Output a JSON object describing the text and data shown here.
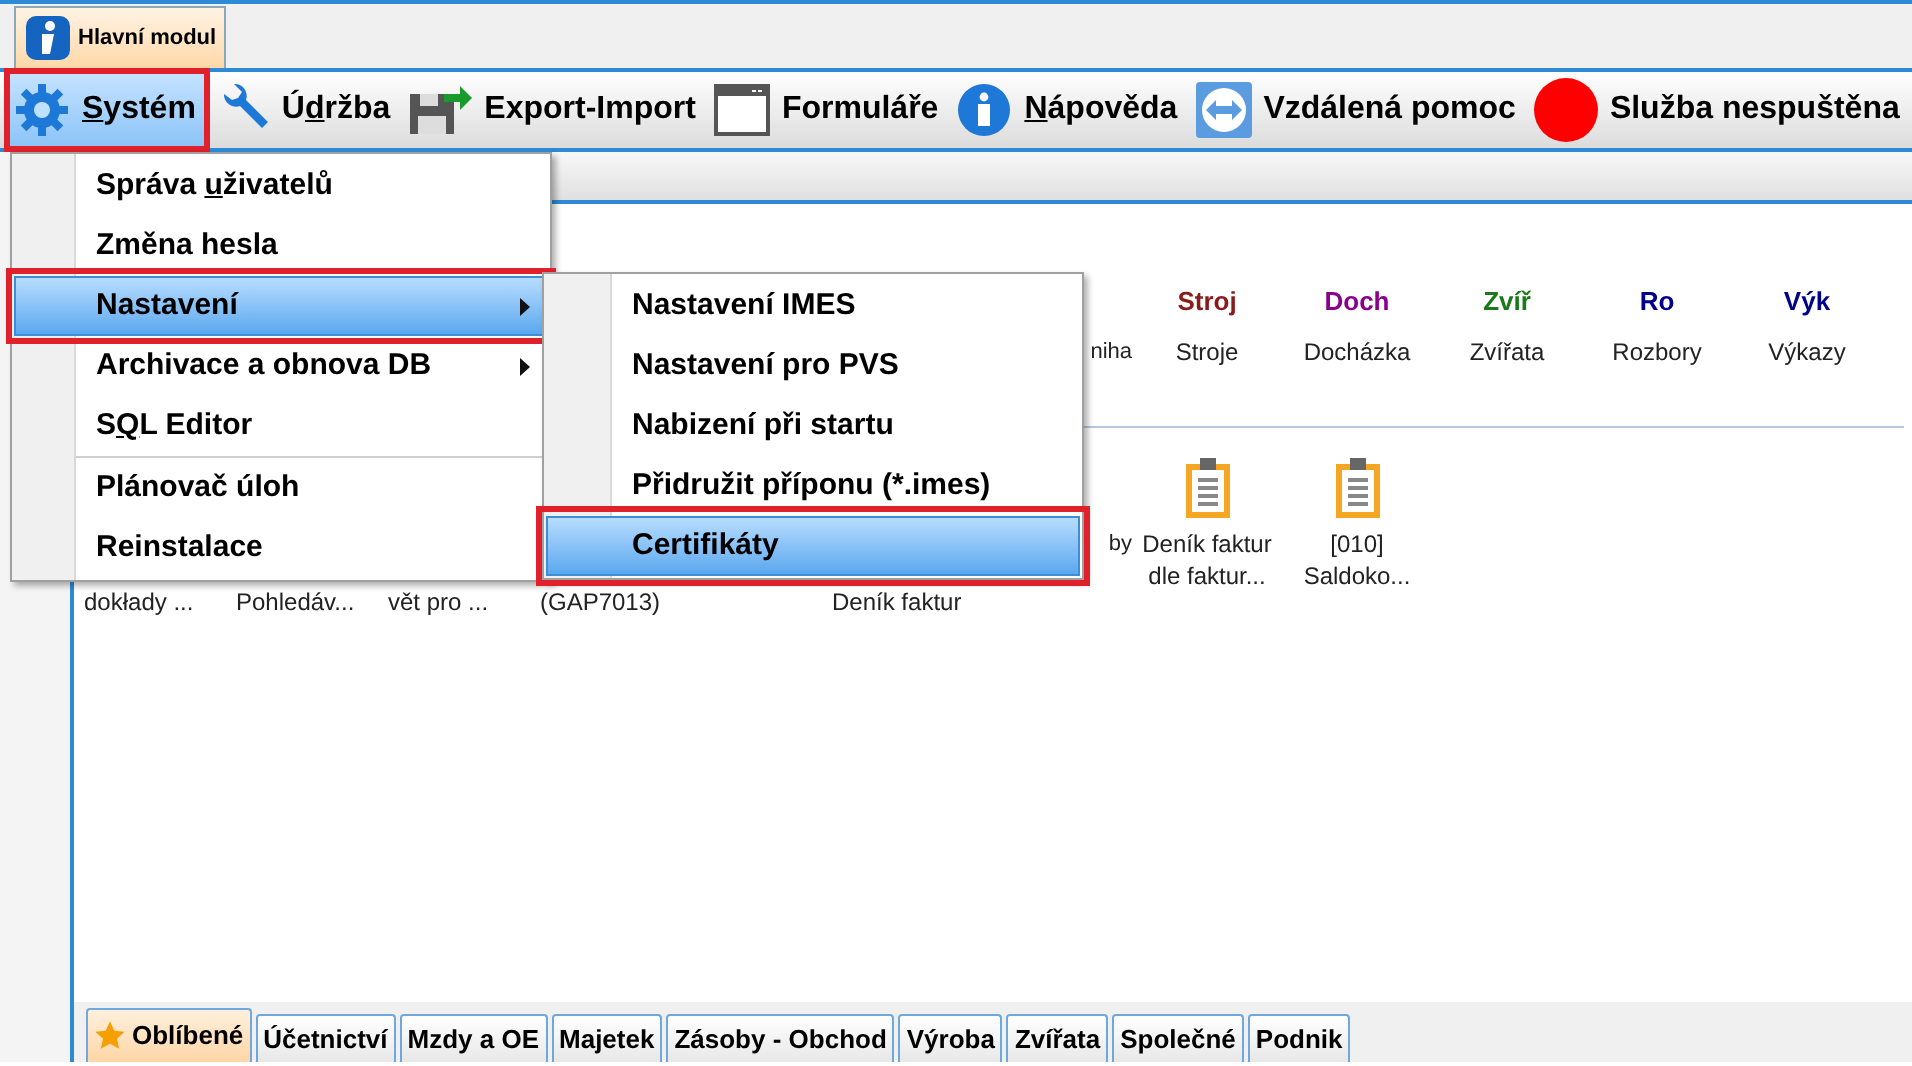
{
  "module_tab": {
    "label": "Hlavní modul",
    "selected": true
  },
  "toolbar": [
    {
      "kind": "gear",
      "key": "S",
      "post": "ystém",
      "highlighted": true
    },
    {
      "kind": "wrench",
      "pre": "Ú",
      "key": "d",
      "post": "ržba",
      "highlighted": false
    },
    {
      "kind": "export",
      "pre": "Export-Import",
      "highlighted": false
    },
    {
      "kind": "window",
      "pre": "Formuláře",
      "highlighted": false
    },
    {
      "kind": "info",
      "key": "N",
      "post": "ápověda",
      "highlighted": false
    },
    {
      "kind": "remote",
      "pre": "Vzdálená pomoc",
      "highlighted": false
    },
    {
      "kind": "status",
      "pre": "Služba nespuštěna",
      "highlighted": false,
      "color": "#ff0000"
    }
  ],
  "modules": [
    {
      "kind": "cut",
      "label": "niha"
    },
    {
      "kind": "icon",
      "badge": "Stroj",
      "label": "Stroje",
      "color": "#8b1a1a"
    },
    {
      "kind": "icon",
      "badge": "Doch",
      "label": "Docházka",
      "color": "#8b008b"
    },
    {
      "kind": "icon",
      "badge": "Zvíř",
      "label": "Zvířata",
      "color": "#1a7a1a"
    },
    {
      "kind": "icon",
      "badge": "Ro",
      "label": "Rozbory",
      "color": "#00008b"
    },
    {
      "kind": "icon",
      "badge": "Výk",
      "label": "Výkazy",
      "color": "#00008b"
    }
  ],
  "favorites_under_menu": [
    "dokłady ...",
    "Pohledáv...",
    "vět pro ...",
    "(GAP7013)",
    "Deník faktur"
  ],
  "favorites": [
    {
      "kind": "cut",
      "label": "by"
    },
    {
      "kind": "clipboard",
      "label": "Deník faktur dle faktur..."
    },
    {
      "kind": "clipboard",
      "label": "[010] Saldoko..."
    }
  ],
  "system_menu": [
    {
      "pre": "Správa ",
      "key": "u",
      "post": "živatelů",
      "submenu": false,
      "selected": false,
      "highlighted": false,
      "separator_before": false
    },
    {
      "pre": "Změna hesla",
      "submenu": false,
      "selected": false,
      "highlighted": false,
      "separator_before": false
    },
    {
      "pre": "Nastavení",
      "submenu": true,
      "selected": true,
      "highlighted": true,
      "separator_before": false
    },
    {
      "pre": "Archivace a obnova DB",
      "submenu": true,
      "selected": false,
      "highlighted": false,
      "separator_before": false
    },
    {
      "pre": "S",
      "key": "Q",
      "post": "L Editor",
      "submenu": false,
      "selected": false,
      "highlighted": false,
      "separator_before": false
    },
    {
      "pre": "Plánovač úloh",
      "submenu": false,
      "selected": false,
      "highlighted": false,
      "separator_before": true
    },
    {
      "pre": "Reinstalace",
      "submenu": false,
      "selected": false,
      "highlighted": false,
      "separator_before": false
    }
  ],
  "settings_menu": [
    {
      "label": "Nastavení IMES",
      "selected": false,
      "highlighted": false
    },
    {
      "label": "Nastavení pro PVS",
      "selected": false,
      "highlighted": false
    },
    {
      "label": "Nabizení při startu",
      "selected": false,
      "highlighted": false
    },
    {
      "label": "Přidružit příponu (*.imes)",
      "selected": false,
      "highlighted": false
    },
    {
      "label": "Certifikáty",
      "selected": true,
      "highlighted": true
    }
  ],
  "bottom_tabs": [
    {
      "label": "Oblíbené",
      "selected": true,
      "star": true
    },
    {
      "label": "Účetnictví",
      "selected": false,
      "star": false
    },
    {
      "label": "Mzdy a OE",
      "selected": false,
      "star": false
    },
    {
      "label": "Majetek",
      "selected": false,
      "star": false
    },
    {
      "label": "Zásoby - Obchod",
      "selected": false,
      "star": false
    },
    {
      "label": "Výroba",
      "selected": false,
      "star": false
    },
    {
      "label": "Zvířata",
      "selected": false,
      "star": false
    },
    {
      "label": "Společné",
      "selected": false,
      "star": false
    },
    {
      "label": "Podnik",
      "selected": false,
      "star": false
    }
  ]
}
